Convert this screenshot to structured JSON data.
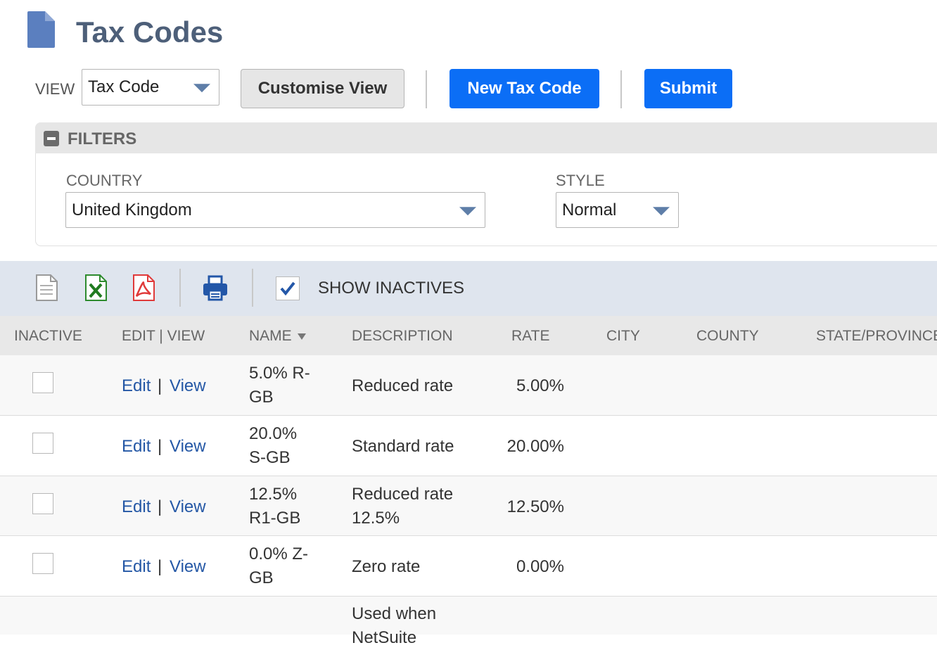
{
  "page": {
    "title": "Tax Codes"
  },
  "toolbar": {
    "view_label": "VIEW",
    "view_value": "Tax Code",
    "customise_label": "Customise View",
    "new_label": "New Tax Code",
    "submit_label": "Submit"
  },
  "filters": {
    "title": "FILTERS",
    "country_label": "COUNTRY",
    "country_value": "United Kingdom",
    "style_label": "STYLE",
    "style_value": "Normal"
  },
  "list_toolbar": {
    "show_inactives_label": "SHOW INACTIVES",
    "show_inactives_checked": true
  },
  "table": {
    "headers": {
      "inactive": "INACTIVE",
      "edit_view": "EDIT | VIEW",
      "name": "NAME",
      "description": "DESCRIPTION",
      "rate": "RATE",
      "city": "CITY",
      "county": "COUNTY",
      "state": "STATE/PROVINCE"
    },
    "edit_label": "Edit",
    "view_label": "View",
    "separator": "|",
    "rows": [
      {
        "name1": "5.0% R-",
        "name2": "GB",
        "desc1": "Reduced rate",
        "desc2": "",
        "rate": "5.00%"
      },
      {
        "name1": "20.0%",
        "name2": "S-GB",
        "desc1": "Standard rate",
        "desc2": "",
        "rate": "20.00%"
      },
      {
        "name1": "12.5%",
        "name2": "R1-GB",
        "desc1": "Reduced rate",
        "desc2": "12.5%",
        "rate": "12.50%"
      },
      {
        "name1": "0.0% Z-",
        "name2": "GB",
        "desc1": "Zero rate",
        "desc2": "",
        "rate": "0.00%"
      }
    ],
    "partial_row": {
      "desc1": "Used when",
      "desc2": "NetSuite"
    }
  }
}
